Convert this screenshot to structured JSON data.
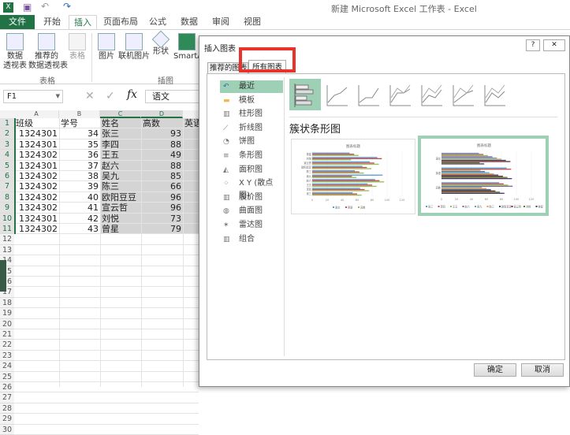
{
  "app": {
    "title": "新建 Microsoft Excel 工作表 - Excel"
  },
  "tabs": [
    {
      "label": "文件"
    },
    {
      "label": "开始"
    },
    {
      "label": "插入"
    },
    {
      "label": "页面布局"
    },
    {
      "label": "公式"
    },
    {
      "label": "数据"
    },
    {
      "label": "审阅"
    },
    {
      "label": "视图"
    }
  ],
  "ribbon": {
    "buttons": [
      {
        "label": "数据\n透视表"
      },
      {
        "label": "推荐的\n数据透视表"
      },
      {
        "label": "表格"
      },
      {
        "label": "图片"
      },
      {
        "label": "联机图片"
      },
      {
        "label": "形状"
      },
      {
        "label": "SmartA"
      }
    ],
    "groups": [
      "表格",
      "插图"
    ]
  },
  "formula": {
    "name_box": "F1",
    "content": "语文"
  },
  "columns": [
    "A",
    "B",
    "C",
    "D"
  ],
  "sheet": {
    "header": [
      "班级",
      "学号",
      "姓名",
      "高数",
      "英语"
    ],
    "rows": [
      [
        "1324301",
        "34",
        "张三",
        "93"
      ],
      [
        "1324301",
        "35",
        "李四",
        "88"
      ],
      [
        "1324302",
        "36",
        "王五",
        "49"
      ],
      [
        "1324301",
        "37",
        "赵六",
        "88"
      ],
      [
        "1324302",
        "38",
        "吴九",
        "85"
      ],
      [
        "1324302",
        "39",
        "陈三",
        "66"
      ],
      [
        "1324302",
        "40",
        "欧阳豆豆",
        "96"
      ],
      [
        "1324302",
        "41",
        "宣云哲",
        "96"
      ],
      [
        "1324301",
        "42",
        "刘悦",
        "73"
      ],
      [
        "1324302",
        "43",
        "曾星",
        "79"
      ]
    ],
    "row_count": 30
  },
  "dialog": {
    "title": "插入图表",
    "help": "?",
    "close": "✕",
    "tabs": [
      "推荐的图表",
      "所有图表"
    ],
    "active_tab": 1,
    "chart_types": [
      {
        "label": "最近",
        "icon": "recent-icon"
      },
      {
        "label": "模板",
        "icon": "folder-icon"
      },
      {
        "label": "柱形图",
        "icon": "column-chart-icon"
      },
      {
        "label": "折线图",
        "icon": "line-chart-icon"
      },
      {
        "label": "饼图",
        "icon": "pie-chart-icon"
      },
      {
        "label": "条形图",
        "icon": "bar-chart-icon"
      },
      {
        "label": "面积图",
        "icon": "area-chart-icon"
      },
      {
        "label": "X Y (散点图)",
        "icon": "scatter-chart-icon"
      },
      {
        "label": "股价图",
        "icon": "stock-chart-icon"
      },
      {
        "label": "曲面图",
        "icon": "surface-chart-icon"
      },
      {
        "label": "雷达图",
        "icon": "radar-chart-icon"
      },
      {
        "label": "组合",
        "icon": "combo-chart-icon"
      }
    ],
    "selected_type": 0,
    "subtype_title": "簇状条形图",
    "preview1": {
      "title": "图表标题",
      "categories": [
        "曾星",
        "刘悦",
        "宣云哲",
        "欧阳豆豆",
        "陈三",
        "吴九",
        "赵六",
        "王五",
        "李四",
        "张三"
      ],
      "legend": [
        "语文",
        "英语",
        "高数"
      ],
      "ticks": [
        "0",
        "20",
        "40",
        "60",
        "80",
        "100",
        "120"
      ]
    },
    "preview2": {
      "title": "图表标题",
      "categories": [
        "语文",
        "英语",
        "高数"
      ],
      "legend": [
        "张三",
        "李四",
        "王五",
        "赵六",
        "吴九",
        "陈三",
        "欧阳豆豆",
        "宣云哲",
        "刘悦",
        "曾星"
      ],
      "ticks": [
        "0",
        "20",
        "40",
        "60",
        "80",
        "100",
        "120"
      ]
    },
    "ok": "确定",
    "cancel": "取消"
  },
  "colors": {
    "accent": "#217346",
    "selection": "#9ed0b5",
    "highlight": "#e8332b"
  }
}
